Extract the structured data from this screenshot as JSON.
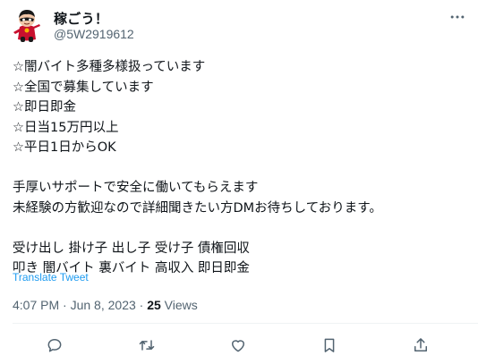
{
  "author": {
    "display_name": "稼ごう！",
    "handle": "@5W2919612",
    "avatar_icon": "cartoon-character-avatar"
  },
  "menu": {
    "more_icon": "more-horizontal-icon"
  },
  "tweet": {
    "lines": [
      "☆闇バイト多種多様扱っています",
      "☆全国で募集しています",
      "☆即日即金",
      "☆日当15万円以上",
      "☆平日1日からOK",
      "",
      "手厚いサポートで安全に働いてもらえます",
      "未経験の方歓迎なので詳細聞きたい方DMお待ちしております。",
      "",
      "受け出し 掛け子 出し子 受け子 債権回収",
      "叩き 闇バイト 裏バイト 高収入 即日即金"
    ],
    "translate_label": "Translate Tweet"
  },
  "meta": {
    "time": "4:07 PM",
    "separator": " · ",
    "date": "Jun 8, 2023",
    "views_count": "25",
    "views_label": " Views"
  },
  "actions": [
    {
      "name": "reply",
      "icon": "reply-icon"
    },
    {
      "name": "retweet",
      "icon": "retweet-icon"
    },
    {
      "name": "like",
      "icon": "heart-icon"
    },
    {
      "name": "bookmark",
      "icon": "bookmark-icon"
    },
    {
      "name": "share",
      "icon": "share-icon"
    }
  ],
  "colors": {
    "text": "#0f1419",
    "secondary": "#536471",
    "link": "#1d9bf0",
    "divider": "#eff3f4",
    "avatar_accent": "#c8102e"
  }
}
